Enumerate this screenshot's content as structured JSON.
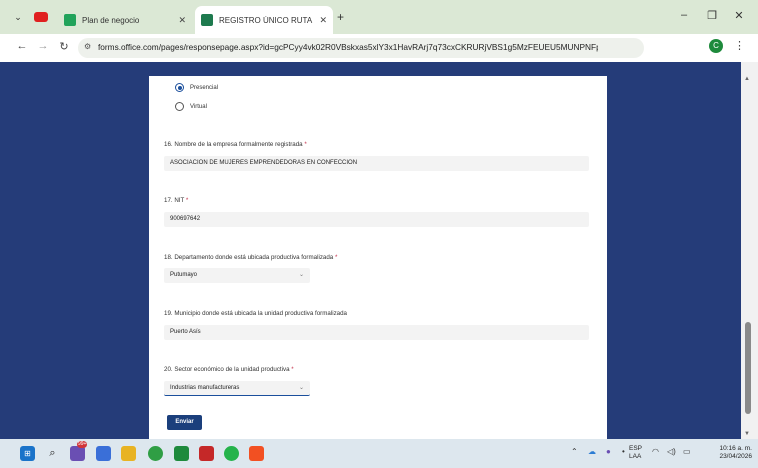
{
  "browser": {
    "tabs": [
      {
        "label": "Plan de negocio",
        "active": false
      },
      {
        "label": "REGISTRO ÚNICO RUTA EMPRE",
        "active": true
      }
    ],
    "url_full": "forms.office.com/pages/responsepage.aspx?id=gcPCyy4vk02R0VBskxas5xlY3x1HavRArj7q73cxCKRURjVBS1g5MzFEUEU5MUNPNFpMTTlNRlFCVC4u...",
    "profile_initial": "C",
    "icons": {
      "back": "arrow-left-icon",
      "forward": "arrow-right-icon",
      "reload": "reload-icon",
      "site_info": "tune-icon",
      "zoom": "zoom-icon",
      "install": "install-app-icon",
      "bookmark": "star-icon",
      "menu": "kebab-icon"
    },
    "accent": "#dbe8d5"
  },
  "form": {
    "radio_options": [
      {
        "label": "Presencial",
        "selected": true
      },
      {
        "label": "Virtual",
        "selected": false
      }
    ],
    "questions": [
      {
        "number_label": "16. Nombre de la empresa formalmente registrada",
        "required": "*",
        "value": "ASOCIACION DE MUJERES EMPRENDEDORAS EN CONFECCION",
        "kind": "text"
      },
      {
        "number_label": "17. NIT",
        "required": "*",
        "value": "900697642",
        "kind": "text"
      },
      {
        "number_label": "18. Departamento donde está ubicada productiva formalizada",
        "required": "*",
        "value": "Putumayo",
        "kind": "select"
      },
      {
        "number_label": "19. Municipio donde está ubicada la unidad productiva formalizada",
        "required": "",
        "value": "Puerto Asís",
        "kind": "text"
      },
      {
        "number_label": "20. Sector económico de la unidad productiva",
        "required": "*",
        "value": "Industrias manufactureras",
        "kind": "select"
      }
    ],
    "submit_label": "Enviar",
    "bg_color": "#253c79",
    "button_color": "#1b3f7c"
  },
  "taskbar": {
    "language_line1": "ESP",
    "language_line2": "LAA",
    "time": "10:16 a. m.",
    "date": "23/04/2026",
    "notification_badge": "99+"
  }
}
